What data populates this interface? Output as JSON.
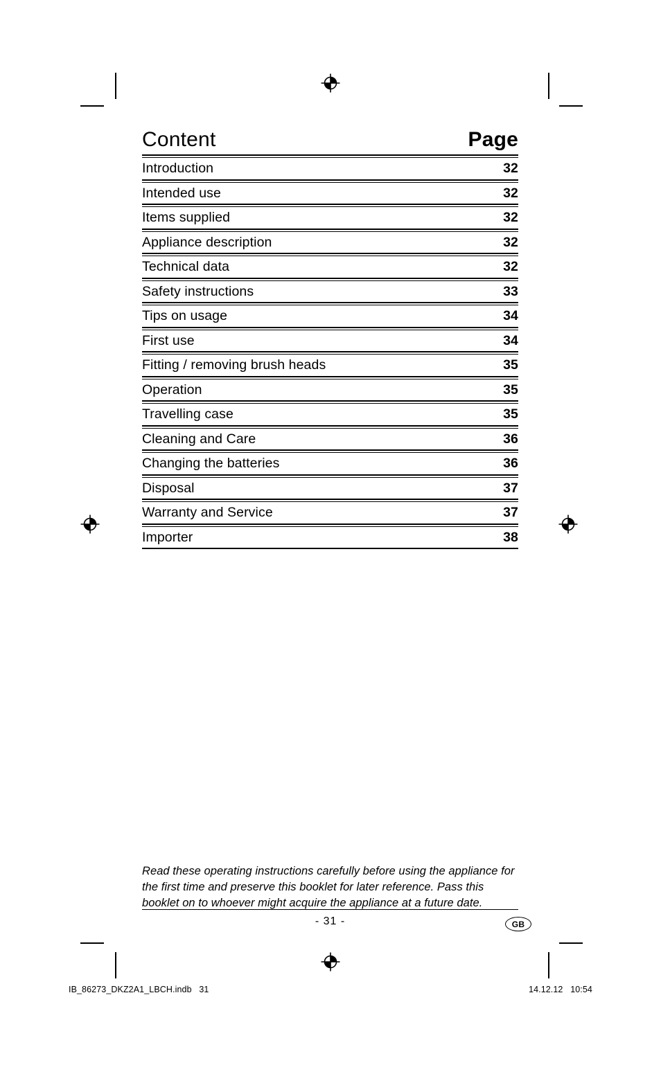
{
  "document": {
    "header": {
      "content_label": "Content",
      "page_label": "Page"
    },
    "toc": [
      {
        "label": "Introduction",
        "page": "32"
      },
      {
        "label": "Intended use",
        "page": "32"
      },
      {
        "label": "Items supplied",
        "page": "32"
      },
      {
        "label": "Appliance description",
        "page": "32"
      },
      {
        "label": "Technical data",
        "page": "32"
      },
      {
        "label": "Safety instructions",
        "page": "33"
      },
      {
        "label": "Tips on usage",
        "page": "34"
      },
      {
        "label": "First use",
        "page": "34"
      },
      {
        "label": "Fitting / removing brush heads",
        "page": "35"
      },
      {
        "label": "Operation",
        "page": "35"
      },
      {
        "label": "Travelling case",
        "page": "35"
      },
      {
        "label": "Cleaning and Care",
        "page": "36"
      },
      {
        "label": "Changing the batteries",
        "page": "36"
      },
      {
        "label": "Disposal",
        "page": "37"
      },
      {
        "label": "Warranty and Service",
        "page": "37"
      },
      {
        "label": "Importer",
        "page": "38"
      }
    ],
    "footer_note": "Read these operating instructions carefully before using the appliance for the first time and preserve this booklet for later reference. Pass this booklet on to whoever might acquire the appliance at a future date.",
    "page_number": "- 31 -",
    "region_badge": "GB",
    "print_slug": {
      "file": "IB_86273_DKZ2A1_LBCH.indb   31",
      "date": "14.12.12   10:54"
    }
  }
}
